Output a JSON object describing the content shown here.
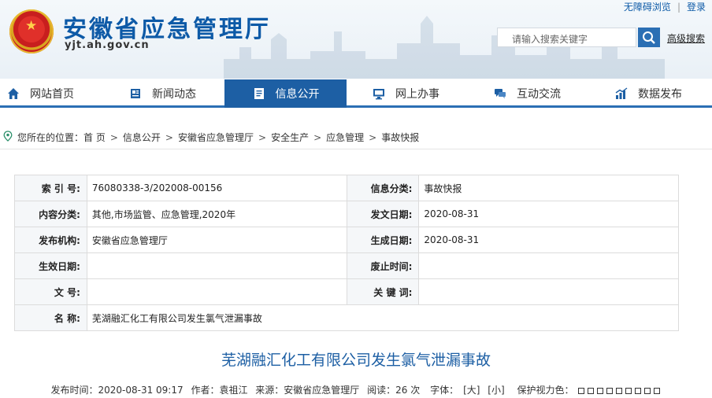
{
  "header": {
    "site_title": "安徽省应急管理厅",
    "site_url": "yjt.ah.gov.cn",
    "toplinks": [
      "无障碍浏览",
      "登录"
    ],
    "search_placeholder": "请输入搜索关键字",
    "advanced_search": "高级搜索"
  },
  "nav": {
    "items": [
      {
        "label": "网站首页",
        "icon": "home-icon"
      },
      {
        "label": "新闻动态",
        "icon": "news-icon"
      },
      {
        "label": "信息公开",
        "icon": "document-icon",
        "active": true
      },
      {
        "label": "网上办事",
        "icon": "monitor-icon"
      },
      {
        "label": "互动交流",
        "icon": "chat-icon"
      },
      {
        "label": "数据发布",
        "icon": "chart-icon"
      }
    ]
  },
  "breadcrumb": {
    "prefix": "您所在的位置：",
    "items": [
      "首 页",
      "信息公开",
      "安徽省应急管理厅",
      "安全生产",
      "应急管理",
      "事故快报"
    ]
  },
  "meta": {
    "rows": [
      [
        {
          "k": "索 引 号:",
          "v": "76080338-3/202008-00156"
        },
        {
          "k": "信息分类:",
          "v": "事故快报"
        }
      ],
      [
        {
          "k": "内容分类:",
          "v": "其他,市场监管、应急管理,2020年"
        },
        {
          "k": "发文日期:",
          "v": "2020-08-31"
        }
      ],
      [
        {
          "k": "发布机构:",
          "v": "安徽省应急管理厅"
        },
        {
          "k": "生成日期:",
          "v": "2020-08-31"
        }
      ],
      [
        {
          "k": "生效日期:",
          "v": ""
        },
        {
          "k": "废止时间:",
          "v": ""
        }
      ],
      [
        {
          "k": "文 号:",
          "v": ""
        },
        {
          "k": "关 键 词:",
          "v": ""
        }
      ]
    ],
    "name_label": "名 称:",
    "name_value": "芜湖融汇化工有限公司发生氯气泄漏事故"
  },
  "article": {
    "title": "芜湖融汇化工有限公司发生氯气泄漏事故",
    "publish_time": "发布时间：2020-08-31 09:17",
    "author": "作者：袁祖江",
    "source": "来源：安徽省应急管理厅",
    "reads": "阅读：26 次",
    "font_label": "字体：",
    "font_large": "[大]",
    "font_small": "[小]",
    "eye_care": "保护视力色："
  },
  "colors": {
    "brand": "#1d5fa4",
    "accent": "#2b6fb4"
  }
}
